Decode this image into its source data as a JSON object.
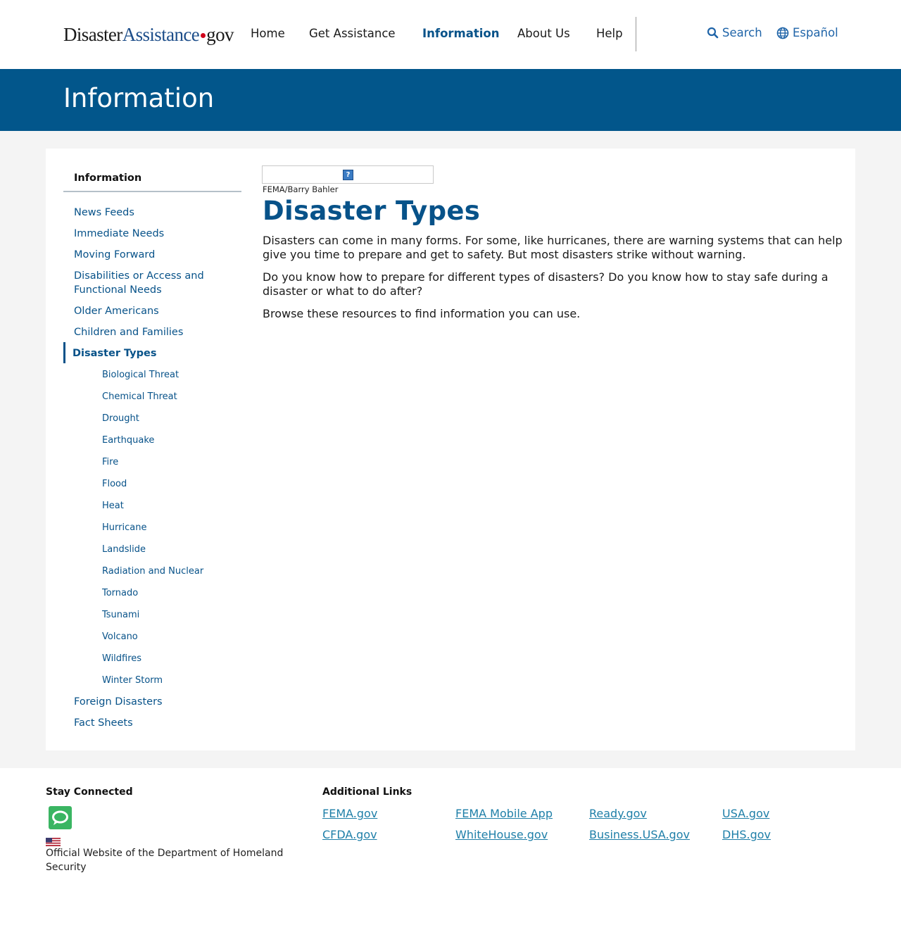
{
  "header": {
    "logo": {
      "part1": "Disaster",
      "part2": "Assistance",
      "part3": "gov"
    },
    "nav": [
      {
        "label": "Home"
      },
      {
        "label": "Get Assistance"
      },
      {
        "label": "Information"
      },
      {
        "label": "About Us"
      },
      {
        "label": "Help"
      }
    ],
    "active_nav": "Information",
    "search_label": "Search",
    "language_label": "Español"
  },
  "banner": {
    "title": "Information"
  },
  "sidebar": {
    "title": "Information",
    "items": [
      {
        "label": "News Feeds"
      },
      {
        "label": "Immediate Needs"
      },
      {
        "label": "Moving Forward"
      },
      {
        "label": "Disabilities or Access and Functional Needs"
      },
      {
        "label": "Older Americans"
      },
      {
        "label": "Children and Families"
      },
      {
        "label": "Disaster Types"
      },
      {
        "label": "Foreign Disasters"
      },
      {
        "label": "Fact Sheets"
      }
    ],
    "current": "Disaster Types",
    "subitems": [
      {
        "label": "Biological Threat"
      },
      {
        "label": "Chemical Threat"
      },
      {
        "label": "Drought"
      },
      {
        "label": "Earthquake"
      },
      {
        "label": "Fire"
      },
      {
        "label": "Flood"
      },
      {
        "label": "Heat"
      },
      {
        "label": "Hurricane"
      },
      {
        "label": "Landslide"
      },
      {
        "label": "Radiation and Nuclear"
      },
      {
        "label": "Tornado"
      },
      {
        "label": "Tsunami"
      },
      {
        "label": "Volcano"
      },
      {
        "label": "Wildfires"
      },
      {
        "label": "Winter Storm"
      }
    ]
  },
  "main": {
    "image_credit": "FEMA/Barry Bahler",
    "title": "Disaster Types",
    "paragraphs": [
      "Disasters can come in many forms. For some, like hurricanes, there are warning systems that can help give you time to prepare and get to safety. But most disasters strike without warning.",
      "Do you know how to prepare for different types of disasters? Do you know how to stay safe during a disaster or what to do after?",
      "Browse these resources to find information you can use."
    ]
  },
  "footer": {
    "stay_connected_title": "Stay Connected",
    "official_text": "Official Website of the Department of Homeland Security",
    "additional_links_title": "Additional Links",
    "links": [
      {
        "label": "FEMA.gov"
      },
      {
        "label": "FEMA Mobile App"
      },
      {
        "label": "Ready.gov"
      },
      {
        "label": "USA.gov"
      },
      {
        "label": "CFDA.gov"
      },
      {
        "label": "WhiteHouse.gov"
      },
      {
        "label": "Business.USA.gov"
      },
      {
        "label": "DHS.gov"
      }
    ]
  },
  "colors": {
    "brand_blue": "#02568b",
    "link_blue": "#075289",
    "footer_link": "#1f7fa8",
    "chat_green": "#3ab562",
    "logo_dot_red": "#d0021b"
  }
}
